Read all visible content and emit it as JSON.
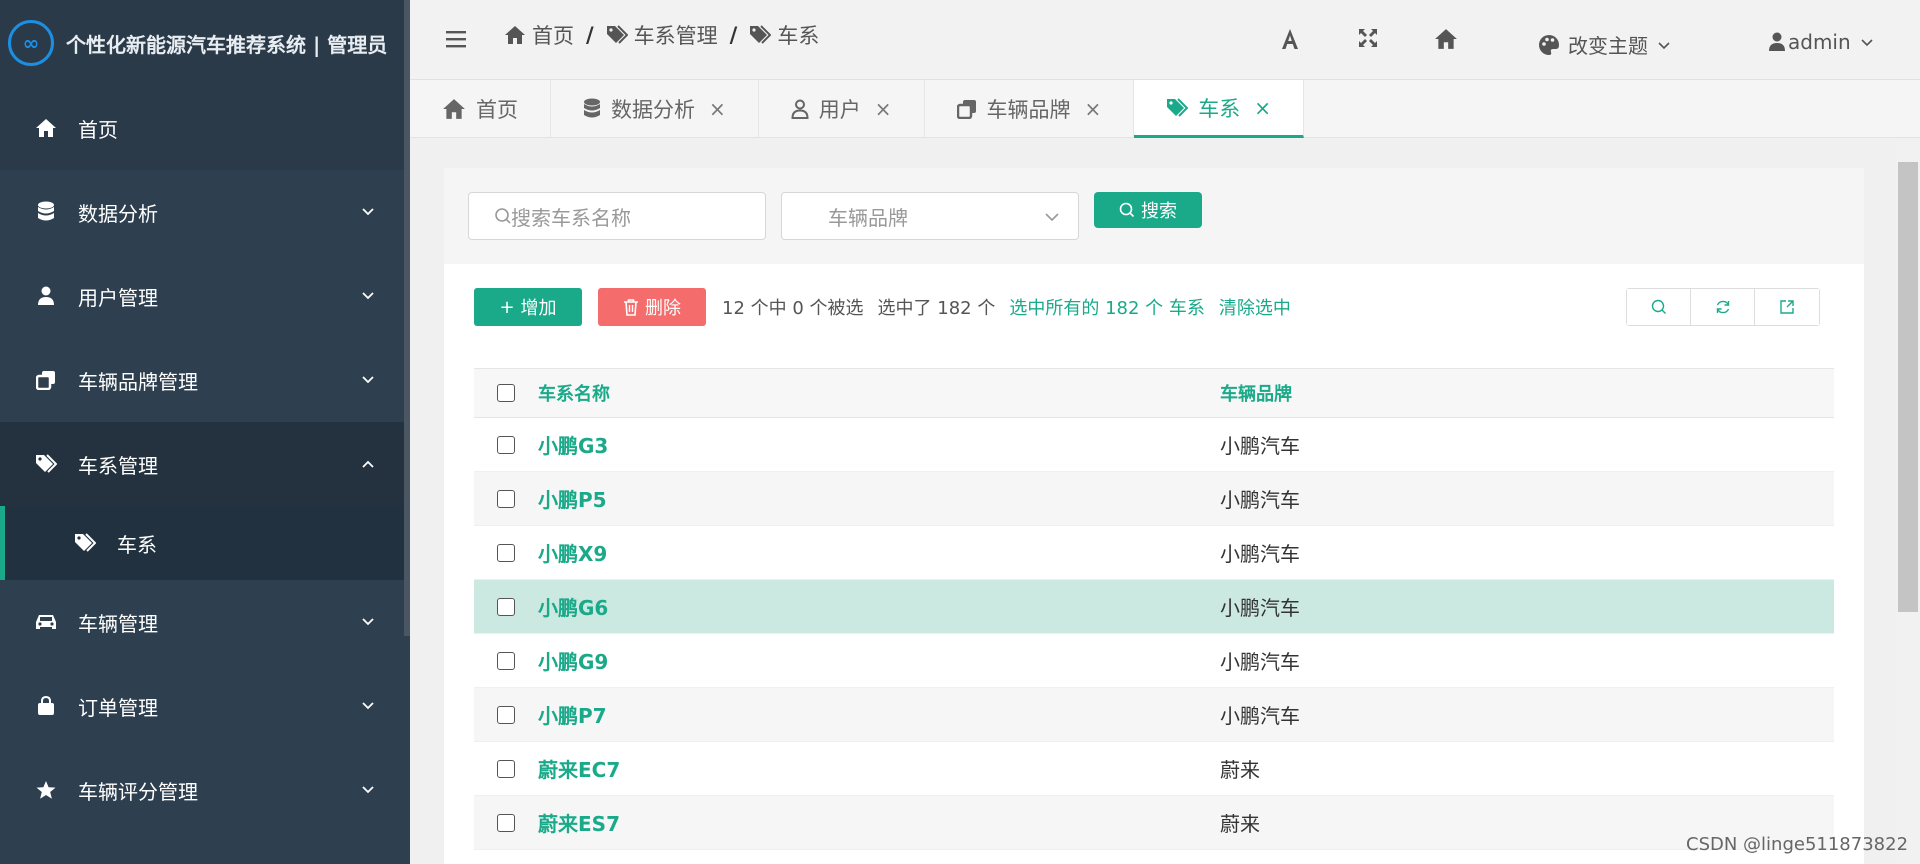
{
  "sidebar": {
    "brand_logo": "∞",
    "brand_title": "个性化新能源汽车推荐系统 | 管理员",
    "items": [
      {
        "label": "首页",
        "icon": "home-icon"
      },
      {
        "label": "数据分析",
        "icon": "database-icon"
      },
      {
        "label": "用户管理",
        "icon": "user-icon"
      },
      {
        "label": "车辆品牌管理",
        "icon": "copy-icon"
      },
      {
        "label": "车系管理",
        "icon": "tags-icon"
      },
      {
        "label": "车辆管理",
        "icon": "car-icon"
      },
      {
        "label": "订单管理",
        "icon": "bag-icon"
      },
      {
        "label": "车辆评分管理",
        "icon": "star-icon"
      }
    ],
    "sub_item": {
      "label": "车系",
      "icon": "tags-icon"
    }
  },
  "header": {
    "breadcrumb": [
      "首页",
      "车系管理",
      "车系"
    ],
    "breadcrumb_sep": "/",
    "theme_label": "改变主题",
    "user_label": "admin"
  },
  "tabs": [
    {
      "label": "首页",
      "closable": false
    },
    {
      "label": "数据分析",
      "closable": true
    },
    {
      "label": "用户",
      "closable": true
    },
    {
      "label": "车辆品牌",
      "closable": true
    },
    {
      "label": "车系",
      "closable": true,
      "active": true
    }
  ],
  "tab_close": "×",
  "search": {
    "name_placeholder": "搜索车系名称",
    "brand_placeholder": "车辆品牌",
    "button_label": "搜索"
  },
  "actions": {
    "add_label": "增加",
    "add_plus": "+",
    "delete_label": "删除",
    "selection_text": "12 个中 0 个被选",
    "selected_count_text": "选中了 182 个",
    "select_all_link": "选中所有的 182 个 车系",
    "clear_link": "清除选中"
  },
  "table": {
    "headers": {
      "name": "车系名称",
      "brand": "车辆品牌"
    },
    "rows": [
      {
        "name": "小鹏G3",
        "brand": "小鹏汽车"
      },
      {
        "name": "小鹏P5",
        "brand": "小鹏汽车"
      },
      {
        "name": "小鹏X9",
        "brand": "小鹏汽车"
      },
      {
        "name": "小鹏G6",
        "brand": "小鹏汽车"
      },
      {
        "name": "小鹏G9",
        "brand": "小鹏汽车"
      },
      {
        "name": "小鹏P7",
        "brand": "小鹏汽车"
      },
      {
        "name": "蔚来EC7",
        "brand": "蔚来"
      },
      {
        "name": "蔚来ES7",
        "brand": "蔚来"
      }
    ]
  },
  "watermark": "CSDN @linge511873822",
  "colors": {
    "accent": "#1aaa8a",
    "danger": "#f56c6c",
    "sidebar": "#2e3f4f"
  }
}
